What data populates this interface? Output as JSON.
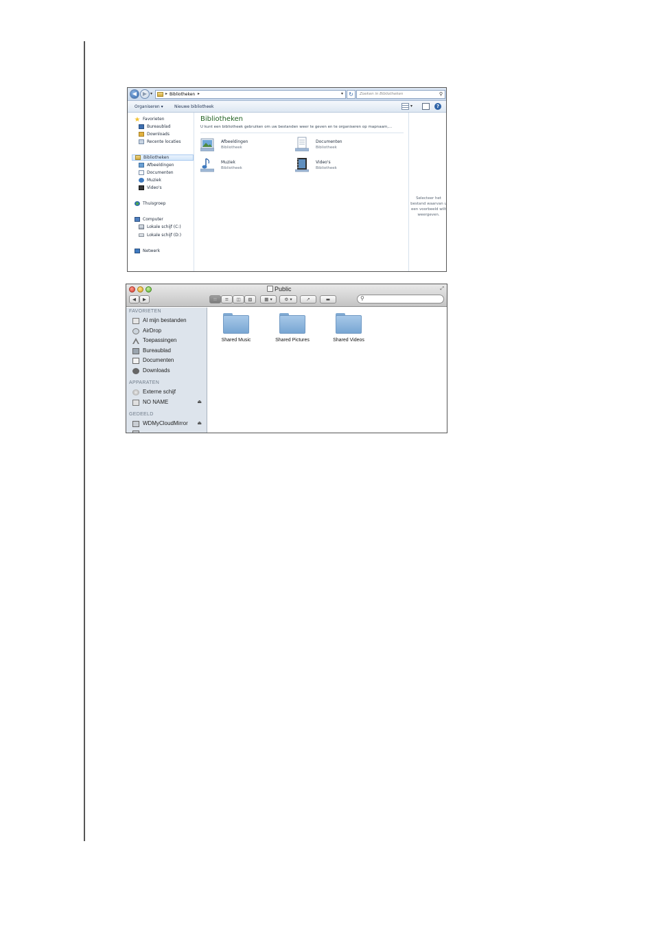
{
  "windows_explorer": {
    "address": {
      "path": "Bibliotheken",
      "search_placeholder": "Zoeken in Bibliotheken"
    },
    "toolbar": {
      "organize": "Organiseren ▾",
      "new_library": "Nieuwe bibliotheek"
    },
    "nav": {
      "favorites_header": "Favorieten",
      "favorites": [
        "Bureaublad",
        "Downloads",
        "Recente locaties"
      ],
      "libraries_header": "Bibliotheken",
      "libraries": [
        "Afbeeldingen",
        "Documenten",
        "Muziek",
        "Video's"
      ],
      "homegroup": "Thuisgroep",
      "computer_header": "Computer",
      "drives": [
        "Lokale schijf (C:)",
        "Lokale schijf (D:)"
      ],
      "network": "Netwerk"
    },
    "content": {
      "title": "Bibliotheken",
      "subtitle": "U kunt een bibliotheek gebruiken om uw bestanden weer te geven en te organiseren op mapnaam,...",
      "items": [
        {
          "name": "Afbeeldingen",
          "type": "Bibliotheek",
          "icon": "pictures-library-icon"
        },
        {
          "name": "Documenten",
          "type": "Bibliotheek",
          "icon": "documents-library-icon"
        },
        {
          "name": "Muziek",
          "type": "Bibliotheek",
          "icon": "music-library-icon"
        },
        {
          "name": "Video's",
          "type": "Bibliotheek",
          "icon": "videos-library-icon"
        }
      ]
    },
    "preview_text": "Selecteer het bestand waarvan u een voorbeeld wilt weergeven."
  },
  "mac_finder": {
    "title": "Public",
    "sidebar": {
      "favorites_header": "FAVORIETEN",
      "favorites": [
        "Al mijn bestanden",
        "AirDrop",
        "Toepassingen",
        "Bureaublad",
        "Documenten",
        "Downloads"
      ],
      "devices_header": "APPARATEN",
      "devices": [
        "Externe schijf",
        "NO NAME"
      ],
      "shared_header": "GEDEELD",
      "shared": [
        "WDMyCloudMirror"
      ]
    },
    "folders": [
      "Shared Music",
      "Shared Pictures",
      "Shared Videos"
    ]
  },
  "colors": {
    "win_title_green": "#1e5f1e",
    "mac_sidebar": "#dde4ec",
    "folder_blue": "#8fb7de"
  }
}
